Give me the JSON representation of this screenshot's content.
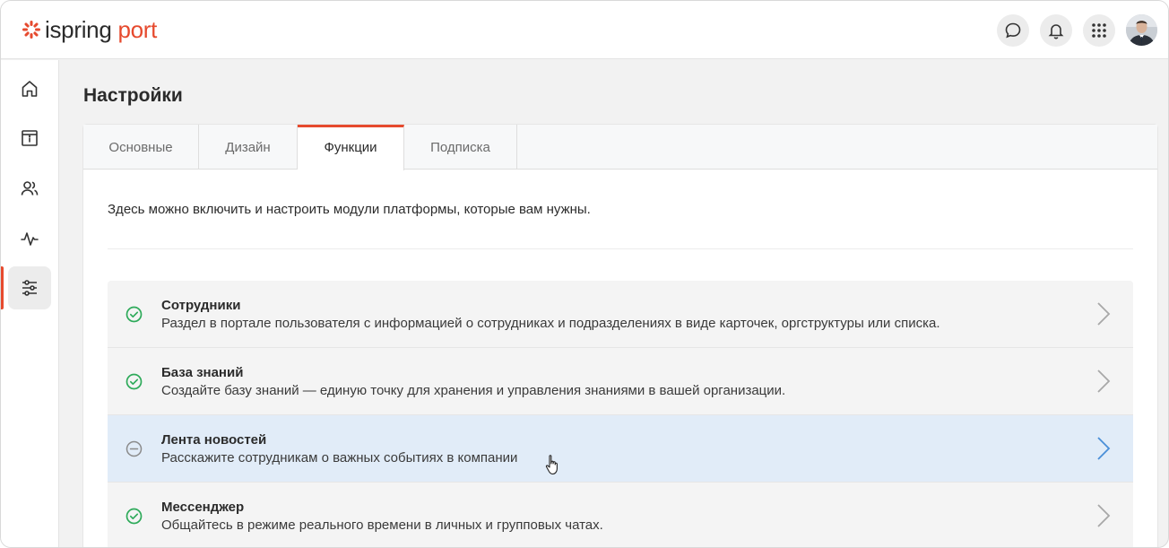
{
  "brand": {
    "name_part1": "ispring",
    "name_part2": "port",
    "accent": "#e64a2e"
  },
  "header": {
    "buttons": [
      {
        "icon": "chat-bubble-icon"
      },
      {
        "icon": "bell-icon"
      },
      {
        "icon": "apps-grid-icon"
      }
    ],
    "avatar": "user-avatar"
  },
  "sidenav": {
    "items": [
      {
        "icon": "home-icon"
      },
      {
        "icon": "info-board-icon"
      },
      {
        "icon": "users-icon"
      },
      {
        "icon": "activity-icon"
      },
      {
        "icon": "settings-sliders-icon",
        "active": true
      }
    ]
  },
  "page": {
    "title": "Настройки"
  },
  "tabs": [
    {
      "label": "Основные"
    },
    {
      "label": "Дизайн"
    },
    {
      "label": "Функции",
      "active": true
    },
    {
      "label": "Подписка"
    }
  ],
  "intro": "Здесь можно включить и настроить модули платформы, которые вам нужны.",
  "modules": [
    {
      "title": "Сотрудники",
      "description": "Раздел в портале пользователя с информацией о сотрудниках и подразделениях в виде карточек, оргструктуры или списка.",
      "status": "enabled"
    },
    {
      "title": "База знаний",
      "description": "Создайте базу знаний — единую точку для хранения и управления знаниями в вашей организации.",
      "status": "enabled"
    },
    {
      "title": "Лента новостей",
      "description": "Расскажите сотрудникам о важных событиях в компании",
      "status": "disabled"
    },
    {
      "title": "Мессенджер",
      "description": "Общайтесь в режиме реального времени в личных и групповых чатах.",
      "status": "enabled"
    }
  ],
  "colors": {
    "enabled": "#2eaa5a",
    "disabled": "#8a8a8a",
    "hover_row": "#e1ecf8",
    "chevron": "#a8a8a8",
    "chevron_active": "#4a8fd8"
  }
}
